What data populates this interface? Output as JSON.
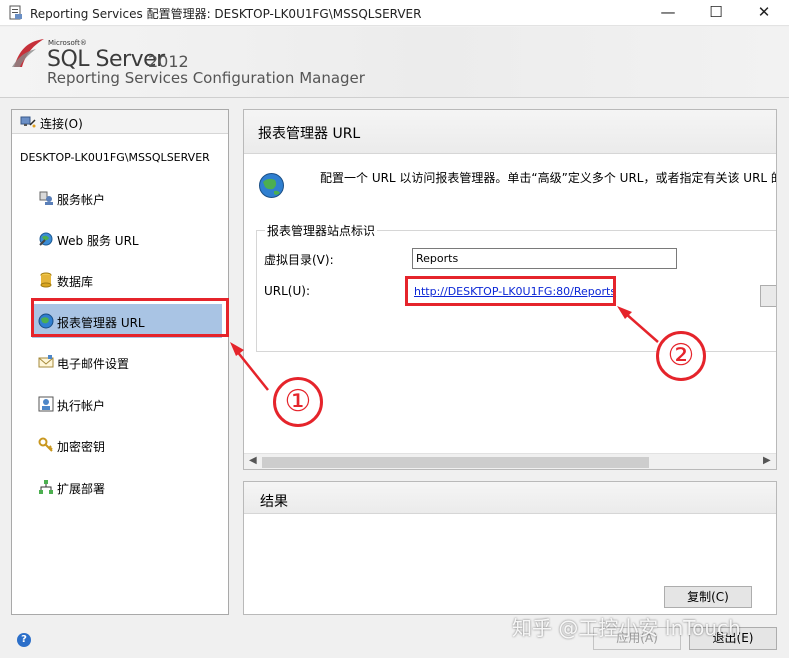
{
  "window": {
    "title": "Reporting Services 配置管理器: DESKTOP-LK0U1FG\\MSSQLSERVER",
    "minimize_glyph": "—",
    "maximize_glyph": "☐",
    "close_glyph": "✕"
  },
  "banner": {
    "microsoft": "Microsoft®",
    "sql_server": "SQL Server",
    "version": "2012",
    "product": "Reporting Services Configuration Manager"
  },
  "nav": {
    "connect_label": "连接(O)",
    "server_name": "DESKTOP-LK0U1FG\\MSSQLSERVER",
    "items": [
      {
        "label": "服务帐户",
        "icon": "service-account-icon"
      },
      {
        "label": "Web 服务 URL",
        "icon": "web-service-icon"
      },
      {
        "label": "数据库",
        "icon": "database-icon"
      },
      {
        "label": "报表管理器 URL",
        "icon": "globe-icon",
        "selected": true
      },
      {
        "label": "电子邮件设置",
        "icon": "email-icon"
      },
      {
        "label": "执行帐户",
        "icon": "execution-account-icon"
      },
      {
        "label": "加密密钥",
        "icon": "key-icon"
      },
      {
        "label": "扩展部署",
        "icon": "scaleout-icon"
      }
    ]
  },
  "main": {
    "header": "报表管理器 URL",
    "description": "配置一个 URL 以访问报表管理器。单击“高级”定义多个 URL，或者指定有关该 URL 的",
    "group_title": "报表管理器站点标识",
    "vdir_label": "虚拟目录(V):",
    "vdir_value": "Reports",
    "url_label": "URL(U):",
    "url_value": "http://DESKTOP-LK0U1FG:80/Reports"
  },
  "results": {
    "header": "结果",
    "copy_label": "复制(C)"
  },
  "footer": {
    "apply_label": "应用(A)",
    "exit_label": "退出(E)",
    "help_glyph": "?"
  },
  "annotations": {
    "callout_1": "①",
    "callout_2": "②",
    "color": "#e5242b"
  },
  "watermark": "知乎 @工控小安 InTouch"
}
